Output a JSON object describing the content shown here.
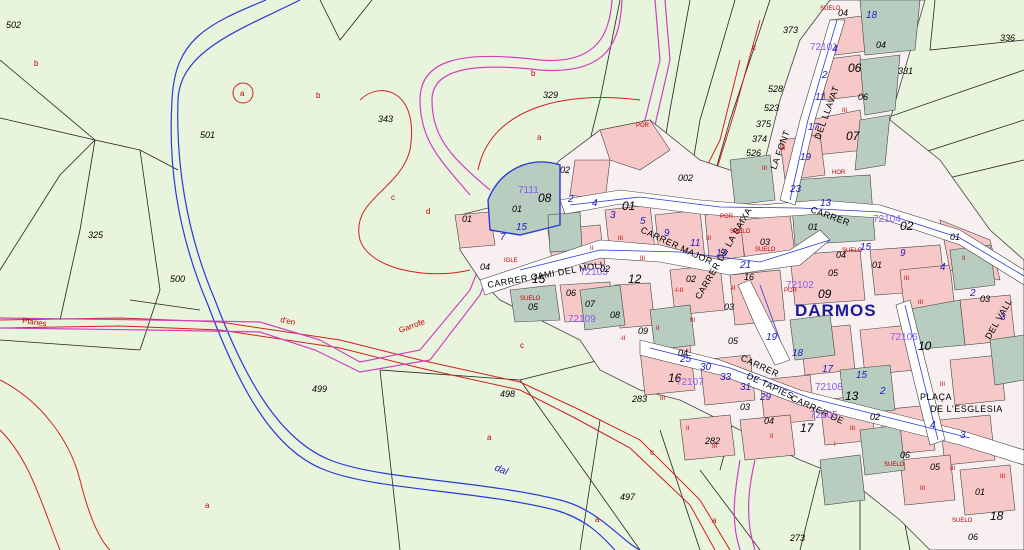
{
  "map": {
    "place_name": "DARMOS",
    "river_label": "dal",
    "road_labels": [
      "Planes",
      "d'en",
      "Garrofe"
    ],
    "parcel_numbers": [
      "502",
      "325",
      "500",
      "501",
      "499",
      "498",
      "497",
      "343",
      "329",
      "283",
      "282",
      "273",
      "336",
      "331",
      "373",
      "528",
      "523",
      "375",
      "374",
      "526",
      "002"
    ],
    "subparcel_letters": [
      "a",
      "b",
      "c",
      "d"
    ],
    "blocks": [
      "01",
      "02",
      "03",
      "04",
      "05",
      "06",
      "07",
      "08",
      "09",
      "10",
      "11",
      "12",
      "13",
      "14",
      "15",
      "16",
      "17",
      "18"
    ],
    "block_codes": [
      "7111",
      "7210",
      "72101",
      "72102",
      "72103",
      "72104",
      "72105",
      "72106",
      "72107",
      "72108",
      "72109"
    ],
    "streets": [
      "CARRER",
      "CAMI",
      "MOLI",
      "MAJOR",
      "CARRER DE",
      "LA FONT",
      "DEL LLAVAT",
      "PLAÇA",
      "DE L'ESGLESIA",
      "DEL VALL",
      "SUELO",
      "CARRER DE LA BAIXA",
      "DE TAPIES"
    ],
    "zone_marks": [
      "I",
      "II",
      "III",
      "-II",
      "-I",
      "POR",
      "SUELO"
    ]
  }
}
